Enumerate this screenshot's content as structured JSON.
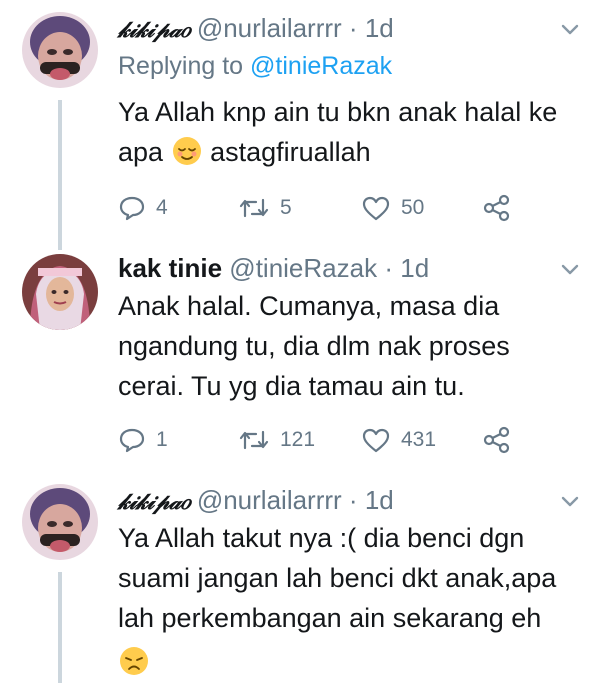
{
  "tweets": [
    {
      "name": "𝓀𝒾𝓀𝒾𝓅𝒶𝑜",
      "handle": "@nurlailarrrr",
      "dot": "·",
      "time": "1d",
      "reply_prefix": "Replying to",
      "reply_target": "@tinieRazak",
      "text_line1": "Ya Allah knp ain tu bkn anak halal ke",
      "text_line2_a": "apa",
      "text_line2_b": "astagfiruallah",
      "emoji": "relieved-face",
      "replies": "4",
      "retweets": "5",
      "likes": "50"
    },
    {
      "name": "kak tinie",
      "handle": "@tinieRazak",
      "dot": "·",
      "time": "1d",
      "text_line1": "Anak halal. Cumanya, masa dia",
      "text_line2": "ngandung tu, dia dlm nak proses",
      "text_line3": "cerai. Tu yg dia tamau ain tu.",
      "replies": "1",
      "retweets": "121",
      "likes": "431"
    },
    {
      "name": "𝓀𝒾𝓀𝒾𝓅𝒶𝑜",
      "handle": "@nurlailarrrr",
      "dot": "·",
      "time": "1d",
      "text_line1": "Ya Allah takut nya :( dia benci dgn",
      "text_line2": "suami jangan lah benci dkt anak,apa",
      "text_line3": "lah perkembangan ain sekarang eh",
      "emoji": "disappointed-face"
    }
  ],
  "colors": {
    "accent": "#1da1f2",
    "muted": "#657786",
    "text": "#14171a",
    "thread": "#ccd6dd"
  }
}
